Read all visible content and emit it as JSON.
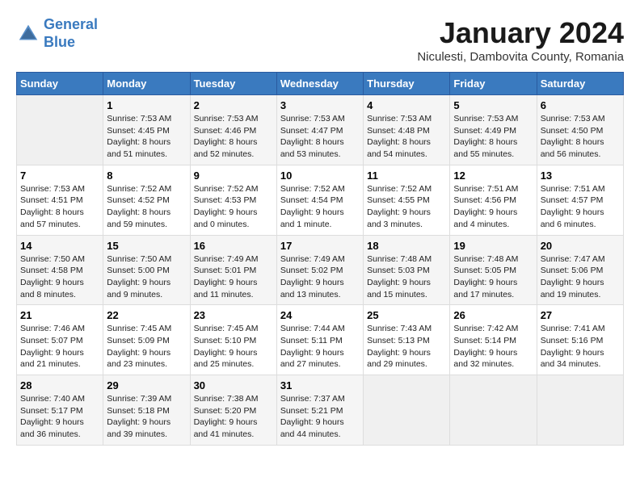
{
  "header": {
    "logo_line1": "General",
    "logo_line2": "Blue",
    "month_title": "January 2024",
    "location": "Niculesti, Dambovita County, Romania"
  },
  "weekdays": [
    "Sunday",
    "Monday",
    "Tuesday",
    "Wednesday",
    "Thursday",
    "Friday",
    "Saturday"
  ],
  "weeks": [
    [
      {
        "day": "",
        "info": ""
      },
      {
        "day": "1",
        "info": "Sunrise: 7:53 AM\nSunset: 4:45 PM\nDaylight: 8 hours\nand 51 minutes."
      },
      {
        "day": "2",
        "info": "Sunrise: 7:53 AM\nSunset: 4:46 PM\nDaylight: 8 hours\nand 52 minutes."
      },
      {
        "day": "3",
        "info": "Sunrise: 7:53 AM\nSunset: 4:47 PM\nDaylight: 8 hours\nand 53 minutes."
      },
      {
        "day": "4",
        "info": "Sunrise: 7:53 AM\nSunset: 4:48 PM\nDaylight: 8 hours\nand 54 minutes."
      },
      {
        "day": "5",
        "info": "Sunrise: 7:53 AM\nSunset: 4:49 PM\nDaylight: 8 hours\nand 55 minutes."
      },
      {
        "day": "6",
        "info": "Sunrise: 7:53 AM\nSunset: 4:50 PM\nDaylight: 8 hours\nand 56 minutes."
      }
    ],
    [
      {
        "day": "7",
        "info": "Sunrise: 7:53 AM\nSunset: 4:51 PM\nDaylight: 8 hours\nand 57 minutes."
      },
      {
        "day": "8",
        "info": "Sunrise: 7:52 AM\nSunset: 4:52 PM\nDaylight: 8 hours\nand 59 minutes."
      },
      {
        "day": "9",
        "info": "Sunrise: 7:52 AM\nSunset: 4:53 PM\nDaylight: 9 hours\nand 0 minutes."
      },
      {
        "day": "10",
        "info": "Sunrise: 7:52 AM\nSunset: 4:54 PM\nDaylight: 9 hours\nand 1 minute."
      },
      {
        "day": "11",
        "info": "Sunrise: 7:52 AM\nSunset: 4:55 PM\nDaylight: 9 hours\nand 3 minutes."
      },
      {
        "day": "12",
        "info": "Sunrise: 7:51 AM\nSunset: 4:56 PM\nDaylight: 9 hours\nand 4 minutes."
      },
      {
        "day": "13",
        "info": "Sunrise: 7:51 AM\nSunset: 4:57 PM\nDaylight: 9 hours\nand 6 minutes."
      }
    ],
    [
      {
        "day": "14",
        "info": "Sunrise: 7:50 AM\nSunset: 4:58 PM\nDaylight: 9 hours\nand 8 minutes."
      },
      {
        "day": "15",
        "info": "Sunrise: 7:50 AM\nSunset: 5:00 PM\nDaylight: 9 hours\nand 9 minutes."
      },
      {
        "day": "16",
        "info": "Sunrise: 7:49 AM\nSunset: 5:01 PM\nDaylight: 9 hours\nand 11 minutes."
      },
      {
        "day": "17",
        "info": "Sunrise: 7:49 AM\nSunset: 5:02 PM\nDaylight: 9 hours\nand 13 minutes."
      },
      {
        "day": "18",
        "info": "Sunrise: 7:48 AM\nSunset: 5:03 PM\nDaylight: 9 hours\nand 15 minutes."
      },
      {
        "day": "19",
        "info": "Sunrise: 7:48 AM\nSunset: 5:05 PM\nDaylight: 9 hours\nand 17 minutes."
      },
      {
        "day": "20",
        "info": "Sunrise: 7:47 AM\nSunset: 5:06 PM\nDaylight: 9 hours\nand 19 minutes."
      }
    ],
    [
      {
        "day": "21",
        "info": "Sunrise: 7:46 AM\nSunset: 5:07 PM\nDaylight: 9 hours\nand 21 minutes."
      },
      {
        "day": "22",
        "info": "Sunrise: 7:45 AM\nSunset: 5:09 PM\nDaylight: 9 hours\nand 23 minutes."
      },
      {
        "day": "23",
        "info": "Sunrise: 7:45 AM\nSunset: 5:10 PM\nDaylight: 9 hours\nand 25 minutes."
      },
      {
        "day": "24",
        "info": "Sunrise: 7:44 AM\nSunset: 5:11 PM\nDaylight: 9 hours\nand 27 minutes."
      },
      {
        "day": "25",
        "info": "Sunrise: 7:43 AM\nSunset: 5:13 PM\nDaylight: 9 hours\nand 29 minutes."
      },
      {
        "day": "26",
        "info": "Sunrise: 7:42 AM\nSunset: 5:14 PM\nDaylight: 9 hours\nand 32 minutes."
      },
      {
        "day": "27",
        "info": "Sunrise: 7:41 AM\nSunset: 5:16 PM\nDaylight: 9 hours\nand 34 minutes."
      }
    ],
    [
      {
        "day": "28",
        "info": "Sunrise: 7:40 AM\nSunset: 5:17 PM\nDaylight: 9 hours\nand 36 minutes."
      },
      {
        "day": "29",
        "info": "Sunrise: 7:39 AM\nSunset: 5:18 PM\nDaylight: 9 hours\nand 39 minutes."
      },
      {
        "day": "30",
        "info": "Sunrise: 7:38 AM\nSunset: 5:20 PM\nDaylight: 9 hours\nand 41 minutes."
      },
      {
        "day": "31",
        "info": "Sunrise: 7:37 AM\nSunset: 5:21 PM\nDaylight: 9 hours\nand 44 minutes."
      },
      {
        "day": "",
        "info": ""
      },
      {
        "day": "",
        "info": ""
      },
      {
        "day": "",
        "info": ""
      }
    ]
  ]
}
